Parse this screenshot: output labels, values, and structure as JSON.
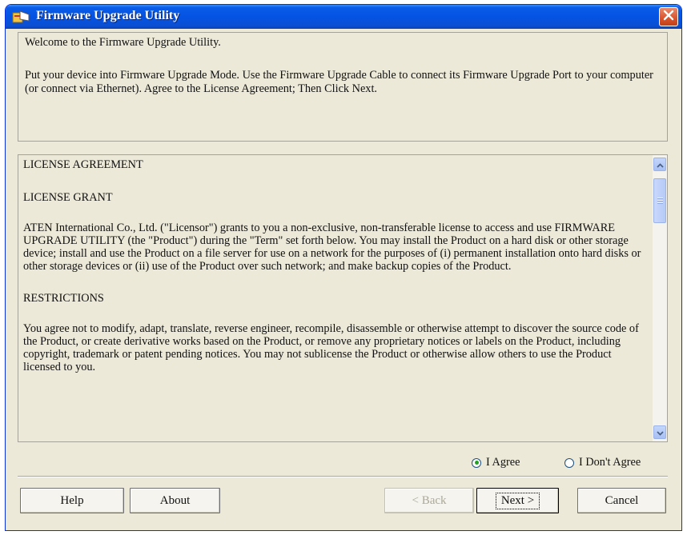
{
  "window": {
    "title": "Firmware Upgrade Utility"
  },
  "intro": {
    "line1": "Welcome to the Firmware Upgrade Utility.",
    "line2": "Put your device into Firmware Upgrade Mode. Use the Firmware Upgrade Cable to connect its Firmware Upgrade Port to your computer (or connect via Ethernet). Agree to the License Agreement; Then Click Next."
  },
  "license": {
    "heading": "LICENSE AGREEMENT",
    "grant_heading": "LICENSE GRANT",
    "grant_text": "ATEN International Co., Ltd. (\"Licensor\") grants to you a non-exclusive, non-transferable license to access and use FIRMWARE UPGRADE UTILITY (the \"Product\") during the \"Term\" set forth below. You may install the Product on a hard disk or other storage device; install and use the Product on a file server for use on a network for the purposes of (i) permanent installation onto hard disks or other storage devices or (ii) use of the Product over such network; and make backup copies of the Product.",
    "restrictions_heading": "RESTRICTIONS",
    "restrictions_text": "You agree not to modify, adapt, translate, reverse engineer, recompile, disassemble or otherwise attempt to discover the source code of the Product, or create derivative works based on the Product, or remove any proprietary notices or labels on the Product, including copyright, trademark or patent pending notices. You may not sublicense the Product or otherwise allow others to use the Product licensed to you."
  },
  "agreement": {
    "agree_label": "I Agree",
    "disagree_label": "I Don't Agree",
    "selected": "I Agree"
  },
  "buttons": {
    "help": "Help",
    "about": "About",
    "back": "< Back",
    "next": "Next >",
    "cancel": "Cancel"
  }
}
